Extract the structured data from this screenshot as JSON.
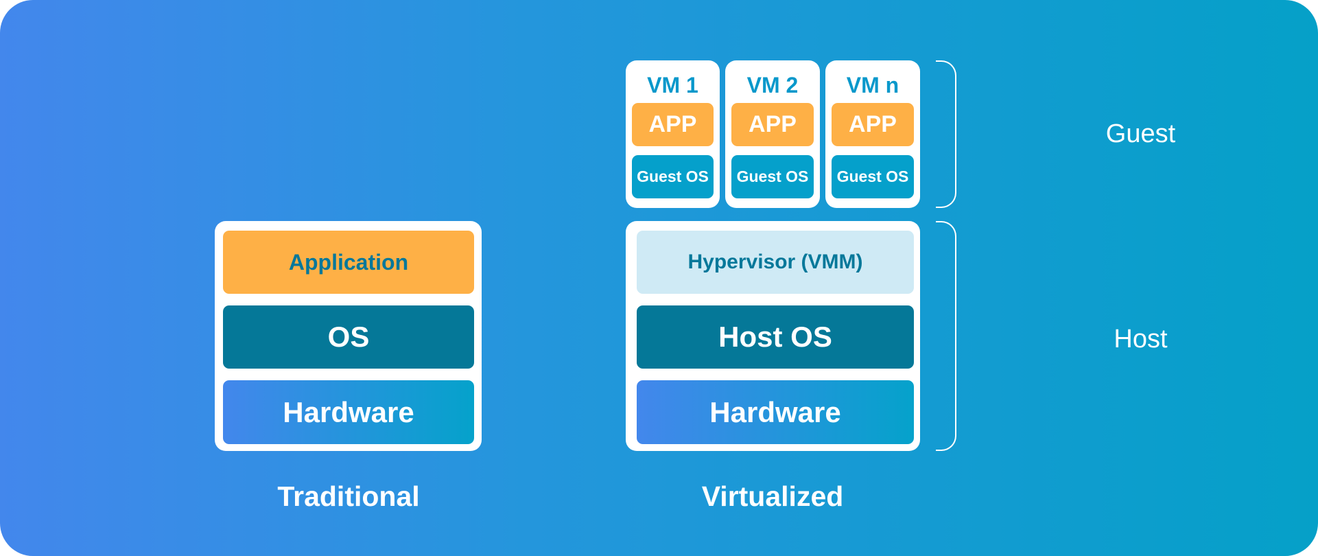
{
  "traditional": {
    "title": "Traditional",
    "layers": [
      "Application",
      "OS",
      "Hardware"
    ]
  },
  "virtualized": {
    "title": "Virtualized",
    "vms": [
      {
        "name": "VM 1",
        "app": "APP",
        "os": "Guest OS"
      },
      {
        "name": "VM 2",
        "app": "APP",
        "os": "Guest OS"
      },
      {
        "name": "VM n",
        "app": "APP",
        "os": "Guest OS"
      }
    ],
    "host_layers": [
      "Hypervisor (VMM)",
      "Host OS",
      "Hardware"
    ]
  },
  "brackets": {
    "guest": "Guest",
    "host": "Host"
  },
  "colors": {
    "app": "#feb046",
    "os": "#057898",
    "guest_os": "#05a0cb",
    "hypervisor": "#cfeaf5",
    "background_start": "#4387ec",
    "background_end": "#05a0c8"
  }
}
